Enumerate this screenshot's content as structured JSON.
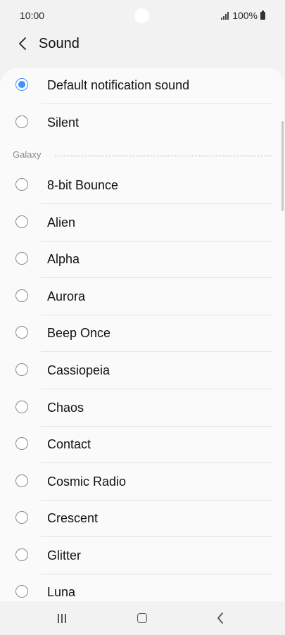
{
  "status_bar": {
    "time": "10:00",
    "battery": "100%"
  },
  "header": {
    "title": "Sound"
  },
  "options_top": [
    {
      "label": "Default notification sound",
      "selected": true
    },
    {
      "label": "Silent",
      "selected": false
    }
  ],
  "section": {
    "label": "Galaxy"
  },
  "options_galaxy": [
    {
      "label": "8-bit Bounce",
      "selected": false
    },
    {
      "label": "Alien",
      "selected": false
    },
    {
      "label": "Alpha",
      "selected": false
    },
    {
      "label": "Aurora",
      "selected": false
    },
    {
      "label": "Beep Once",
      "selected": false
    },
    {
      "label": "Cassiopeia",
      "selected": false
    },
    {
      "label": "Chaos",
      "selected": false
    },
    {
      "label": "Contact",
      "selected": false
    },
    {
      "label": "Cosmic Radio",
      "selected": false
    },
    {
      "label": "Crescent",
      "selected": false
    },
    {
      "label": "Glitter",
      "selected": false
    },
    {
      "label": "Luna",
      "selected": false
    }
  ],
  "colors": {
    "accent": "#3e91ff",
    "background": "#f2f2f2",
    "card": "#fafafa"
  },
  "icons": {
    "back": "chevron-left-icon",
    "signal": "signal-icon",
    "battery": "battery-icon",
    "nav_recents": "recents-icon",
    "nav_home": "home-icon",
    "nav_back": "back-icon"
  }
}
